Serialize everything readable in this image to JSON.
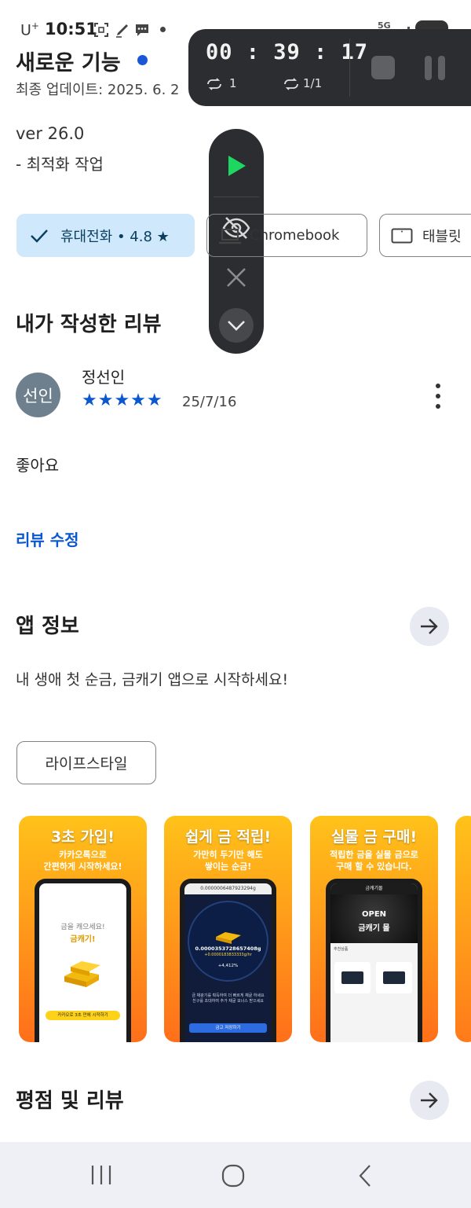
{
  "status_bar": {
    "carrier": "U",
    "carrier_sup": "+",
    "time": "10:51",
    "network": "5G"
  },
  "recorder": {
    "timer": "00 : 39 : 17",
    "loop_count": "1",
    "loop_progress": "1/1"
  },
  "whats_new": {
    "title": "새로운 기능",
    "updated": "최종 업데이트: 2025. 6. 2",
    "version": "ver 26.0",
    "note": "- 최적화 작업"
  },
  "device_chips": [
    {
      "label": "휴대전화 • 4.8 ★",
      "selected": true
    },
    {
      "label": "Chromebook",
      "selected": false
    },
    {
      "label": "태블릿",
      "selected": false
    }
  ],
  "my_review": {
    "heading": "내가 작성한 리뷰",
    "avatar_text": "선인",
    "reviewer": "정선인",
    "stars": "★★★★★",
    "rating": 5,
    "date": "25/7/16",
    "text": "좋아요",
    "edit_link": "리뷰 수정"
  },
  "app_info": {
    "heading": "앱 정보",
    "description": "내 생애 첫 순금, 금캐기 앱으로 시작하세요!",
    "category_tag": "라이프스타일"
  },
  "screenshots": [
    {
      "title": "3초 가입!",
      "subtitle_1": "카카오톡으로",
      "subtitle_2": "간편하게 시작하세요!",
      "line_1": "금을 캐으세요!",
      "line_2": "금캐기!",
      "button": "카카오로 3초 만에 시작하기"
    },
    {
      "title": "쉽게 금 적립!",
      "subtitle_1": "가만히 두기만 해도",
      "subtitle_2": "쌓이는 순금!",
      "top_value": "0.0000006487923294g",
      "amount": "0.0000353728657408g",
      "rate": "+0.0000183833333g/hr",
      "change": "+4,412%",
      "info_1": "금 채광기를 획득하여 더 빠르게 채굴 하세요",
      "info_2": "친구를 초대하여 추가 채굴 보너스 받으세요",
      "cta": "금고 저장하기"
    },
    {
      "title": "실물 금 구매!",
      "subtitle_1": "적립한 금을 실물 금으로",
      "subtitle_2": "구매 할 수 있습니다.",
      "header": "금캐기몰",
      "banner_1": "OPEN",
      "banner_2": "금캐기 몰",
      "section": "추천상품"
    }
  ],
  "ratings": {
    "heading": "평점 및 리뷰"
  },
  "colors": {
    "accent_blue": "#0b57d0",
    "chip_selected_bg": "#cfe8fb",
    "recorder_bg": "#2b2d30",
    "play_green": "#1ed760",
    "avatar_bg": "#6e7f8d",
    "nav_bg": "#eef0f6"
  },
  "icons": {
    "status": [
      "screenshot-icon",
      "pen-icon",
      "chat-icon",
      "wifi-icon",
      "battery-icon"
    ],
    "recorder": [
      "loop-icon",
      "repeat-icon",
      "stop-icon",
      "pause-icon",
      "play-icon",
      "hide-icon",
      "close-icon",
      "chevron-down-icon"
    ],
    "nav": [
      "recent-apps-icon",
      "home-icon",
      "back-icon"
    ]
  }
}
